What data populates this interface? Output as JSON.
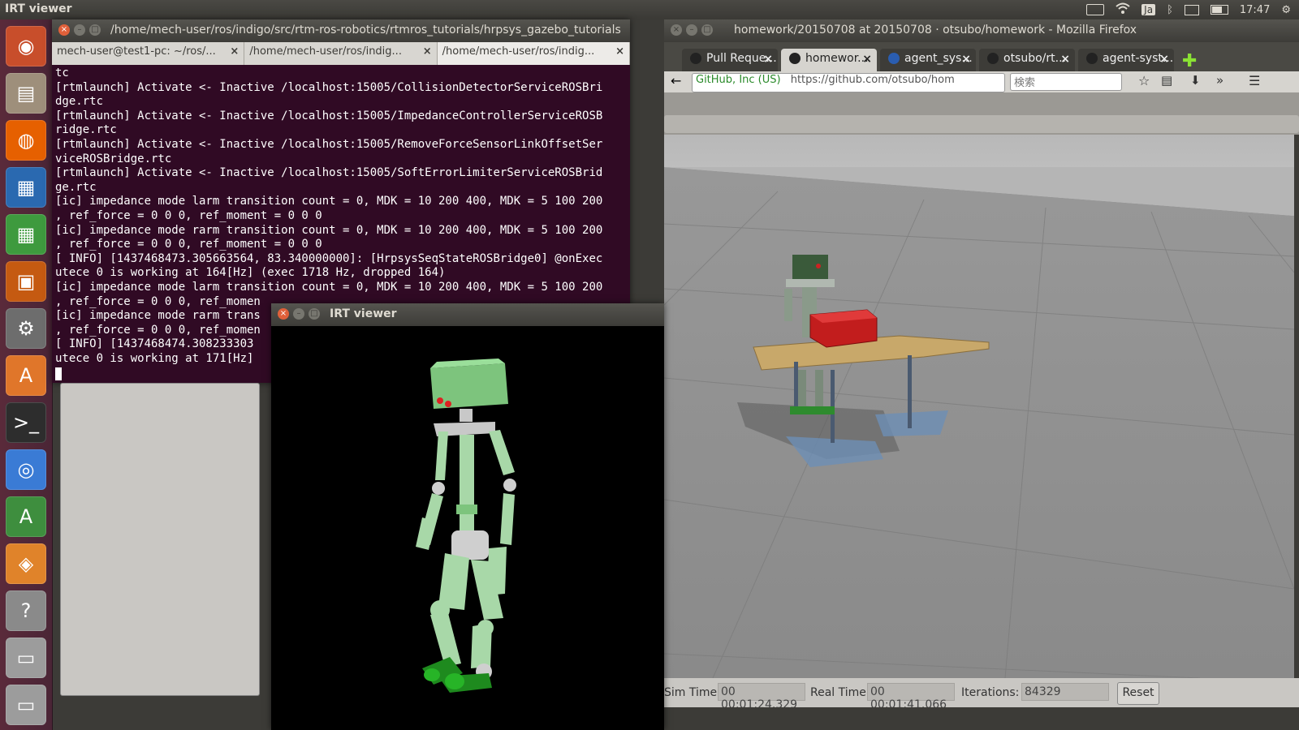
{
  "topbar": {
    "active_app": "IRT viewer",
    "input_method": "Ja",
    "clock": "17:47"
  },
  "launcher": {
    "items": [
      {
        "name": "Ubuntu Dash",
        "icon": "ubuntu-logo-icon",
        "color": "#c84e2b"
      },
      {
        "name": "Files",
        "icon": "file-cabinet-icon",
        "color": "#9e8f7b"
      },
      {
        "name": "Firefox",
        "icon": "firefox-icon",
        "color": "#e66000"
      },
      {
        "name": "Writer",
        "icon": "writer-doc-icon",
        "color": "#2a69b0"
      },
      {
        "name": "Calc",
        "icon": "calc-sheet-icon",
        "color": "#3e9a3e"
      },
      {
        "name": "Impress",
        "icon": "impress-slide-icon",
        "color": "#c55a11"
      },
      {
        "name": "System Settings",
        "icon": "settings-wrench-icon",
        "color": "#6d6d6d"
      },
      {
        "name": "Software Center",
        "icon": "shopping-bag-icon",
        "color": "#e0762a"
      },
      {
        "name": "Terminal",
        "icon": "terminal-icon",
        "color": "#2d2d2d"
      },
      {
        "name": "Chromium",
        "icon": "chromium-icon",
        "color": "#3a7bd5"
      },
      {
        "name": "Software Updater",
        "icon": "updater-icon",
        "color": "#3e8e3e"
      },
      {
        "name": "Gazebo",
        "icon": "gazebo-box-icon",
        "color": "#e0832a"
      },
      {
        "name": "Help",
        "icon": "help-icon",
        "color": "#8a8a8a"
      },
      {
        "name": "Disk",
        "icon": "disk-drive-icon",
        "color": "#9c9c9c"
      },
      {
        "name": "Trash",
        "icon": "trash-icon",
        "color": "#9c9c9c"
      }
    ]
  },
  "terminal": {
    "title": "/home/mech-user/ros/indigo/src/rtm-ros-robotics/rtmros_tutorials/hrpsys_gazebo_tutorials",
    "tabs": [
      {
        "label": "mech-user@test1-pc: ~/ros/..."
      },
      {
        "label": "/home/mech-user/ros/indig..."
      },
      {
        "label": "/home/mech-user/ros/indig..."
      }
    ],
    "lines": [
      "tc",
      "[rtmlaunch] Activate <- Inactive /localhost:15005/CollisionDetectorServiceROSBri",
      "dge.rtc",
      "[rtmlaunch] Activate <- Inactive /localhost:15005/ImpedanceControllerServiceROSB",
      "ridge.rtc",
      "[rtmlaunch] Activate <- Inactive /localhost:15005/RemoveForceSensorLinkOffsetSer",
      "viceROSBridge.rtc",
      "[rtmlaunch] Activate <- Inactive /localhost:15005/SoftErrorLimiterServiceROSBrid",
      "ge.rtc",
      "[ic] impedance mode larm transition count = 0, MDK = 10 200 400, MDK = 5 100 200",
      ", ref_force = 0 0 0, ref_moment = 0 0 0",
      "[ic] impedance mode rarm transition count = 0, MDK = 10 200 400, MDK = 5 100 200",
      ", ref_force = 0 0 0, ref_moment = 0 0 0",
      "[ INFO] [1437468473.305663564, 83.340000000]: [HrpsysSeqStateROSBridge0] @onExec",
      "utece 0 is working at 164[Hz] (exec 1718 Hz, dropped 164)",
      "[ic] impedance mode larm transition count = 0, MDK = 10 200 400, MDK = 5 100 200",
      ", ref_force = 0 0 0, ref_momen",
      "[ic] impedance mode rarm trans",
      ", ref_force = 0 0 0, ref_momen",
      "[ INFO] [1437468474.308233303",
      "utece 0 is working at 171[Hz]"
    ]
  },
  "firefox": {
    "title": "homework/20150708 at 20150708 · otsubo/homework - Mozilla Firefox",
    "tabs": [
      {
        "label": "Pull Reque...",
        "active": false
      },
      {
        "label": "homewor...",
        "active": true
      },
      {
        "label": "agent_sys...",
        "active": false
      },
      {
        "label": "otsubo/rt...",
        "active": false
      },
      {
        "label": "agent-syst...",
        "active": false
      }
    ],
    "url_identity": "GitHub, Inc (US)",
    "url": "https://github.com/otsubo/hom",
    "search_placeholder": "検索"
  },
  "gazebo": {
    "sim_time_label": "Sim Time:",
    "sim_time": "00 00:01:24.329",
    "real_time_label": "Real Time:",
    "real_time": "00 00:01:41.066",
    "iterations_label": "Iterations:",
    "iterations": "84329",
    "reset_label": "Reset"
  },
  "irt_viewer": {
    "title": "IRT viewer"
  }
}
